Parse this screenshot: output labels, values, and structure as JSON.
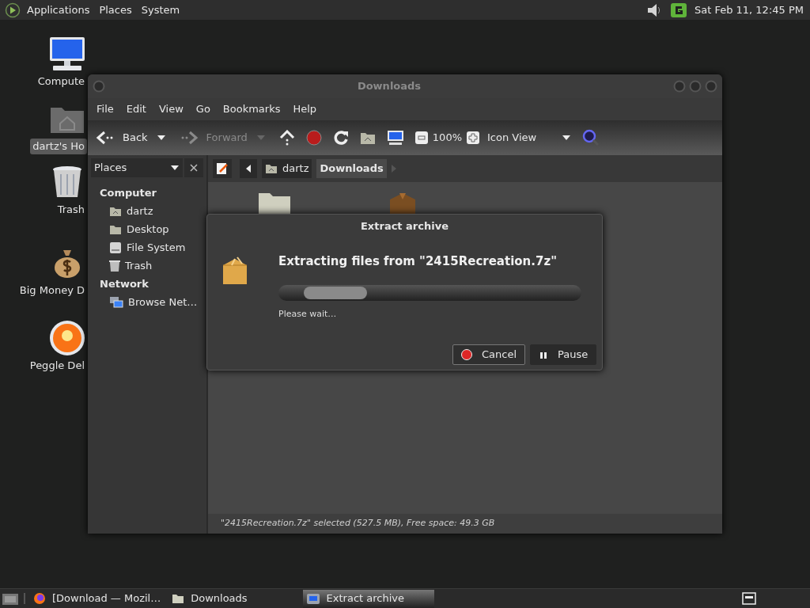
{
  "top_panel": {
    "menus": [
      "Applications",
      "Places",
      "System"
    ],
    "clock": "Sat Feb 11, 12:45 PM"
  },
  "desktop_icons": [
    {
      "label": "Compute",
      "kind": "computer",
      "selected": false
    },
    {
      "label": "dartz's Ho",
      "kind": "home",
      "selected": true
    },
    {
      "label": "Trash",
      "kind": "trash",
      "selected": false
    },
    {
      "label": "Big Money D",
      "kind": "money",
      "selected": false
    },
    {
      "label": "Peggle Del",
      "kind": "peggle",
      "selected": false
    }
  ],
  "file_manager": {
    "title": "Downloads",
    "menu": [
      "File",
      "Edit",
      "View",
      "Go",
      "Bookmarks",
      "Help"
    ],
    "nav_buttons": [
      {
        "label": "Back",
        "kind": "back",
        "disabled": false
      },
      {
        "label": "Forward",
        "kind": "forward",
        "disabled": true
      }
    ],
    "zoom": "100%",
    "view": "Icon View",
    "sidebar": {
      "selector": "Places",
      "sections": [
        {
          "heading": "Computer",
          "items": [
            {
              "label": "dartz",
              "kind": "home"
            },
            {
              "label": "Desktop",
              "kind": "desktop"
            },
            {
              "label": "File System",
              "kind": "drive"
            },
            {
              "label": "Trash",
              "kind": "trash"
            }
          ]
        },
        {
          "heading": "Network",
          "items": [
            {
              "label": "Browse Net…",
              "kind": "network"
            }
          ]
        }
      ]
    },
    "path": [
      {
        "label": "dartz",
        "selected": false
      },
      {
        "label": "Downloads",
        "selected": true
      }
    ],
    "files": [
      {
        "kind": "folder"
      },
      {
        "kind": "package"
      }
    ],
    "status": "\"2415Recreation.7z\" selected (527.5 MB), Free space: 49.3 GB"
  },
  "dialog": {
    "title": "Extract archive",
    "heading": "Extracting files from \"2415Recreation.7z\"",
    "message": "Please wait…",
    "buttons": [
      {
        "label": "Cancel",
        "kind": "cancel"
      },
      {
        "label": "Pause",
        "kind": "pause"
      }
    ]
  },
  "taskbar": {
    "tasks": [
      {
        "label": "[Download — Mozil…",
        "kind": "browser",
        "selected": false
      },
      {
        "label": "Downloads",
        "kind": "folder",
        "selected": false
      },
      {
        "label": "Extract archive",
        "kind": "extract",
        "selected": true
      }
    ]
  }
}
